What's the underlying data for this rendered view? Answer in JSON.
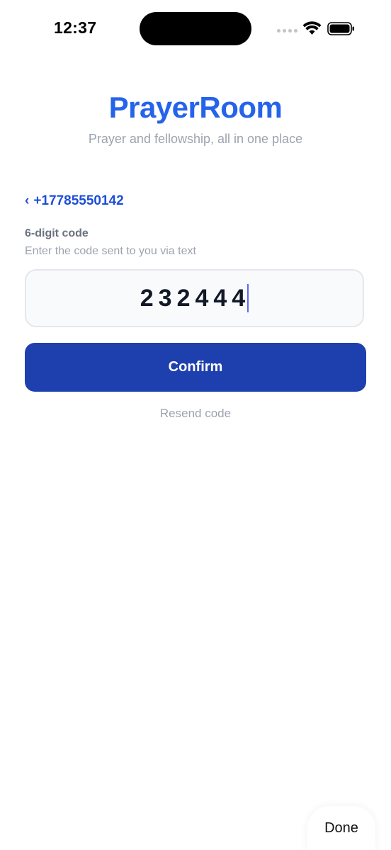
{
  "status_bar": {
    "time": "12:37",
    "icons": [
      "signal-icon",
      "wifi-icon",
      "battery-icon"
    ]
  },
  "brand": {
    "title": "PrayerRoom",
    "subtitle": "Prayer and fellowship, all in one place",
    "color": "#2563eb"
  },
  "back": {
    "chevron": "‹",
    "phone": "+17785550142"
  },
  "code_field": {
    "label": "6-digit code",
    "hint": "Enter the code sent to you via text",
    "value": "232444"
  },
  "actions": {
    "confirm_label": "Confirm",
    "confirm_color": "#1e40af",
    "resend_label": "Resend code"
  },
  "keyboard_toolbar": {
    "done_label": "Done"
  }
}
